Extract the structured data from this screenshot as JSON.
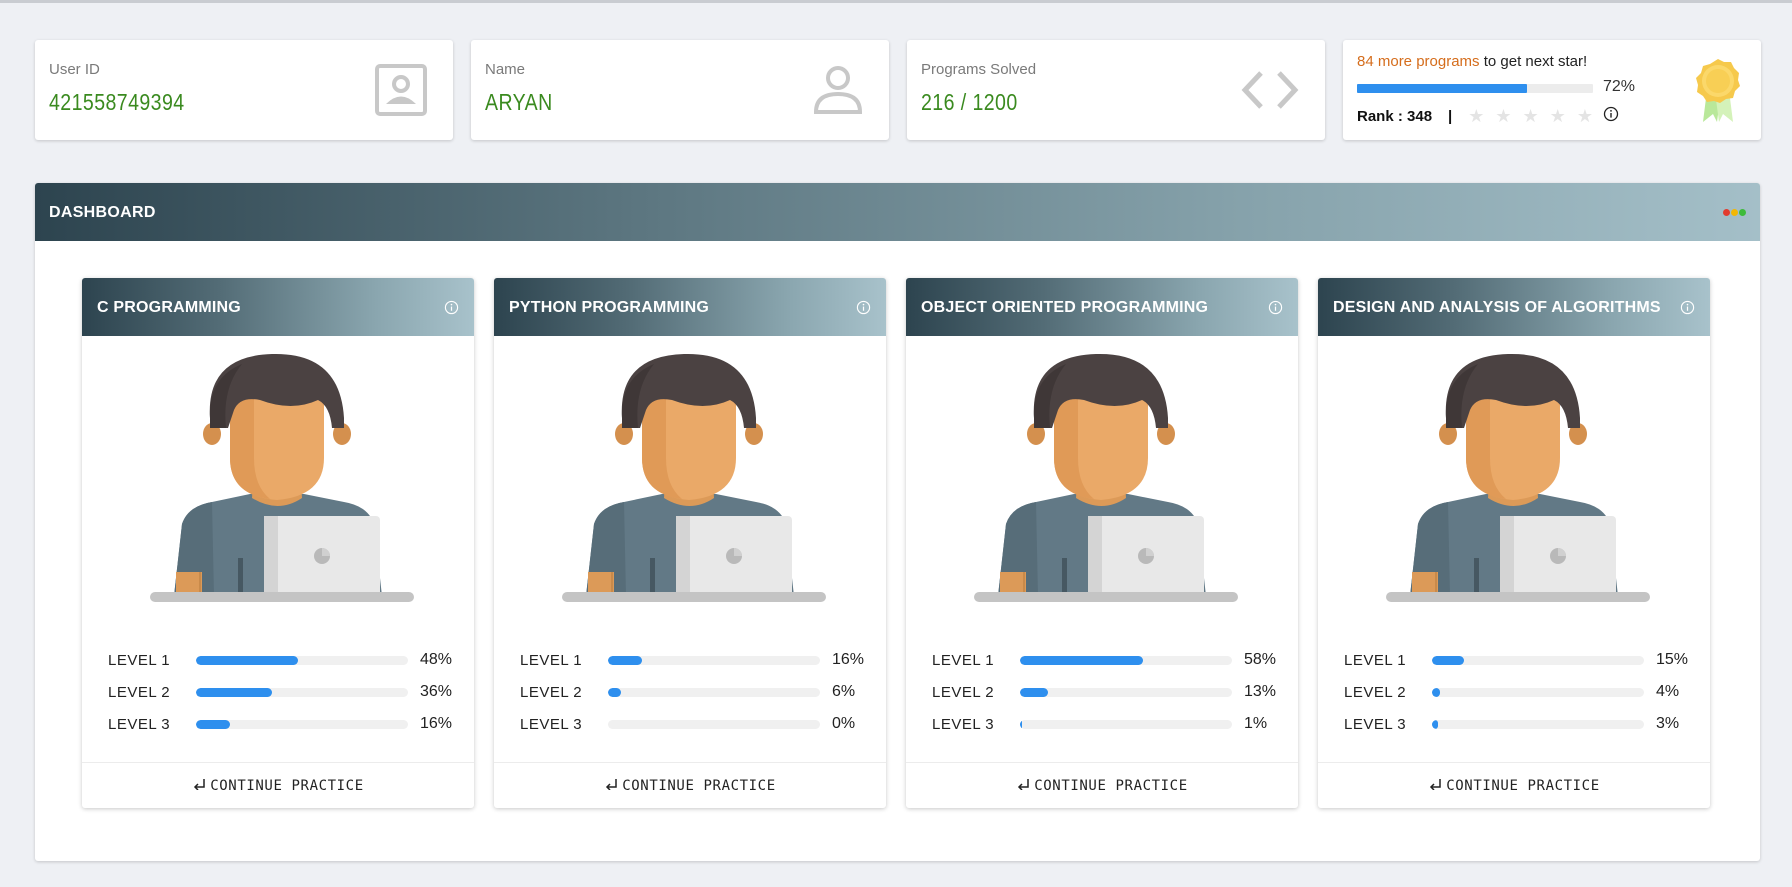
{
  "stats": {
    "user_id": {
      "label": "User ID",
      "value": "421558749394"
    },
    "name": {
      "label": "Name",
      "value": "ARYAN"
    },
    "programs": {
      "label": "Programs Solved",
      "value": "216 / 1200"
    }
  },
  "star": {
    "count_text": "84 more programs",
    "suffix_text": "to get next star!",
    "progress": 0.72,
    "progress_label": "72%",
    "rank_text": "Rank : 348",
    "separator": "|",
    "stars": [
      "★",
      "★",
      "★",
      "★",
      "★"
    ]
  },
  "dashboard": {
    "title": "DASHBOARD",
    "dot_colors": [
      "#e23b2e",
      "#f2b705",
      "#3dbb3a"
    ]
  },
  "courses": [
    {
      "title": "C PROGRAMMING",
      "levels": [
        {
          "label": "LEVEL 1",
          "value": 0.48,
          "pct": "48%"
        },
        {
          "label": "LEVEL 2",
          "value": 0.36,
          "pct": "36%"
        },
        {
          "label": "LEVEL 3",
          "value": 0.16,
          "pct": "16%"
        }
      ],
      "action": "CONTINUE PRACTICE"
    },
    {
      "title": "PYTHON PROGRAMMING",
      "levels": [
        {
          "label": "LEVEL 1",
          "value": 0.16,
          "pct": "16%"
        },
        {
          "label": "LEVEL 2",
          "value": 0.06,
          "pct": "6%"
        },
        {
          "label": "LEVEL 3",
          "value": 0.0,
          "pct": "0%"
        }
      ],
      "action": "CONTINUE PRACTICE"
    },
    {
      "title": "OBJECT ORIENTED PROGRAMMING",
      "levels": [
        {
          "label": "LEVEL 1",
          "value": 0.58,
          "pct": "58%"
        },
        {
          "label": "LEVEL 2",
          "value": 0.13,
          "pct": "13%"
        },
        {
          "label": "LEVEL 3",
          "value": 0.01,
          "pct": "1%"
        }
      ],
      "action": "CONTINUE PRACTICE"
    },
    {
      "title": "DESIGN AND ANALYSIS OF ALGORITHMS",
      "levels": [
        {
          "label": "LEVEL 1",
          "value": 0.15,
          "pct": "15%"
        },
        {
          "label": "LEVEL 2",
          "value": 0.04,
          "pct": "4%"
        },
        {
          "label": "LEVEL 3",
          "value": 0.03,
          "pct": "3%"
        }
      ],
      "action": "CONTINUE PRACTICE"
    }
  ],
  "colors": {
    "accent": "#2e8fee",
    "value_green": "#3a8a1f",
    "highlight_orange": "#d56d1c"
  },
  "icons": {
    "user_id": "id-badge-icon",
    "name": "user-icon",
    "programs": "code-brackets-icon",
    "medal": "medal-ribbon-icon",
    "info": "info-circle-icon",
    "action": "return-arrow-icon"
  }
}
